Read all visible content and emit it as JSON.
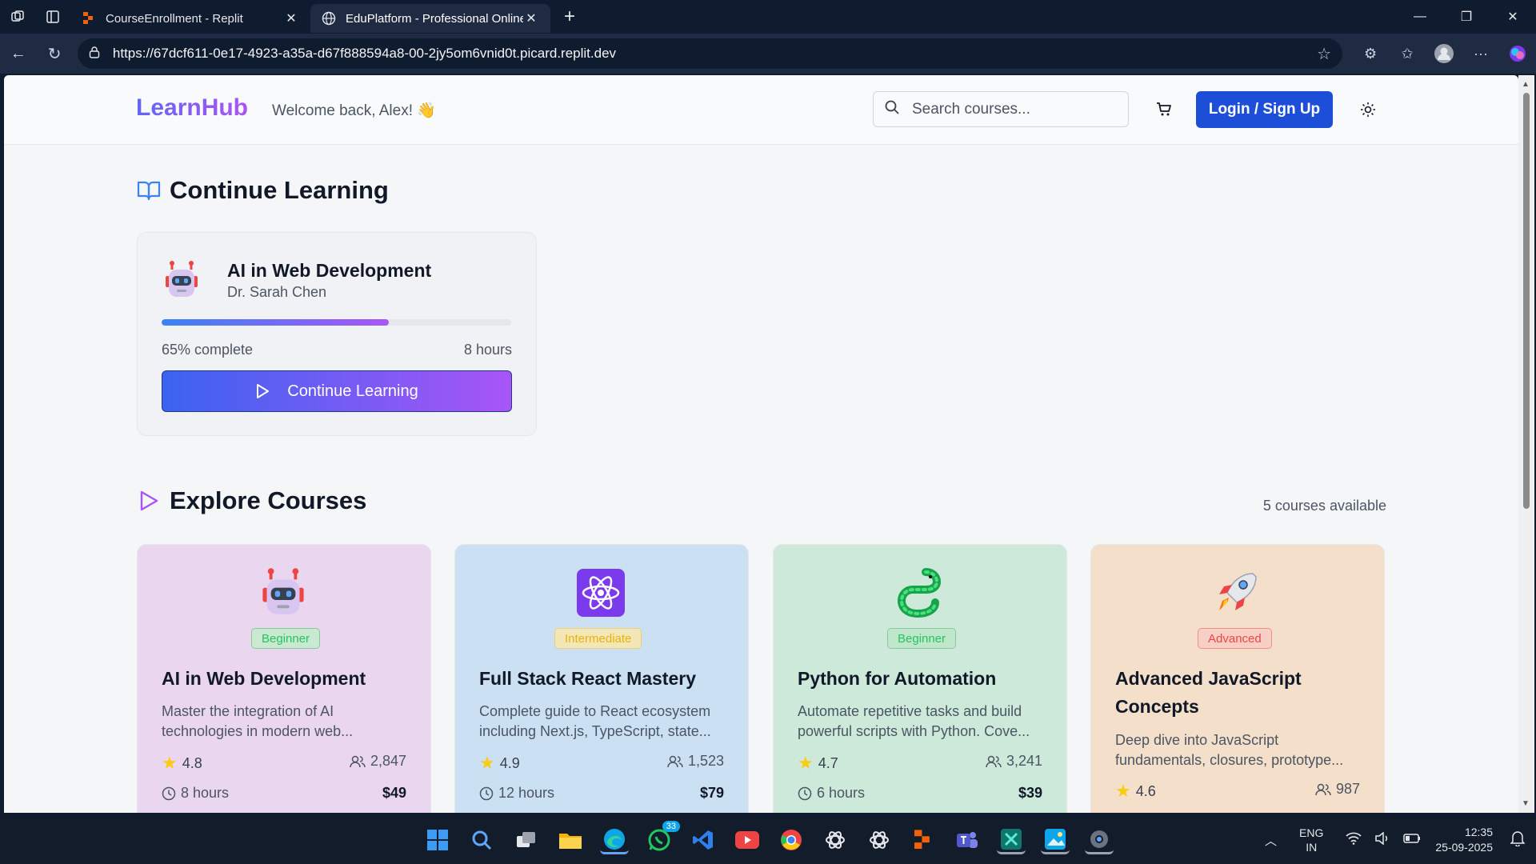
{
  "browser": {
    "tabs": [
      {
        "label": "CourseEnrollment - Replit",
        "active": false
      },
      {
        "label": "EduPlatform - Professional Online",
        "active": true
      }
    ],
    "url": "https://67dcf611-0e17-4923-a35a-d67f888594a8-00-2jy5om6vnid0t.picard.replit.dev"
  },
  "header": {
    "logo": "LearnHub",
    "welcome": "Welcome back, Alex! 👋",
    "search_placeholder": "Search courses...",
    "login_label": "Login / Sign Up"
  },
  "continue_section": {
    "title": "Continue Learning",
    "course": {
      "emoji": "🤖",
      "title": "AI in Web Development",
      "instructor": "Dr. Sarah Chen",
      "progress_percent": 65,
      "progress_label": "65% complete",
      "hours": "8 hours",
      "button_label": "Continue Learning"
    }
  },
  "explore_section": {
    "title": "Explore Courses",
    "count_label": "5 courses available",
    "courses": [
      {
        "emoji": "🤖",
        "level": "Beginner",
        "title": "AI in Web Development",
        "desc": "Master the integration of AI technologies in modern web...",
        "rating": "4.8",
        "students": "2,847",
        "duration": "8 hours",
        "price": "$49",
        "bg": "#e9d5f0"
      },
      {
        "emoji": "⚛️",
        "level": "Intermediate",
        "title": "Full Stack React Mastery",
        "desc": "Complete guide to React ecosystem including Next.js, TypeScript, state...",
        "rating": "4.9",
        "students": "1,523",
        "duration": "12 hours",
        "price": "$79",
        "bg": "#cfe0f3"
      },
      {
        "emoji": "🐍",
        "level": "Beginner",
        "title": "Python for Automation",
        "desc": "Automate repetitive tasks and build powerful scripts with Python. Cove...",
        "rating": "4.7",
        "students": "3,241",
        "duration": "6 hours",
        "price": "$39",
        "bg": "#cdebdc"
      },
      {
        "emoji": "🚀",
        "level": "Advanced",
        "title": "Advanced JavaScript Concepts",
        "desc": "Deep dive into JavaScript fundamentals, closures, prototype...",
        "rating": "4.6",
        "students": "987",
        "duration": "",
        "price": "",
        "bg": "#f5e0cc"
      }
    ]
  },
  "taskbar": {
    "whatsapp_badge": "33",
    "lang_line1": "ENG",
    "lang_line2": "IN",
    "time": "12:35",
    "date": "25-09-2025"
  },
  "colors": {
    "primary": "#1d4ed8",
    "gradient_start": "#3b82f6",
    "gradient_end": "#a855f7",
    "beginner": "#22c55e",
    "intermediate": "#eab308",
    "advanced": "#ef4444"
  }
}
